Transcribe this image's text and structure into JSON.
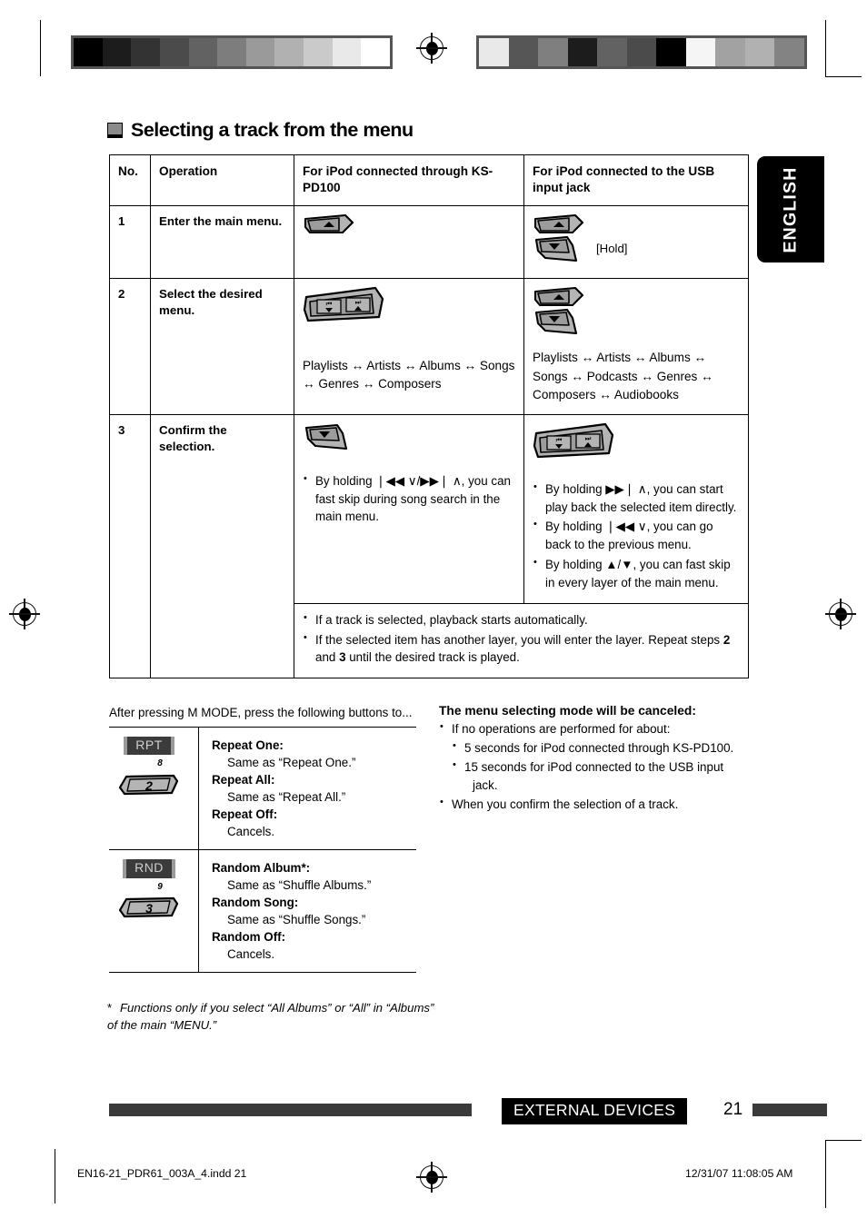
{
  "page": {
    "heading": "Selecting a track from the menu",
    "language_tab": "ENGLISH",
    "chapter_tag": "EXTERNAL DEVICES",
    "page_number": "21",
    "file_name": "EN16-21_PDR61_003A_4.indd   21",
    "timestamp": "12/31/07   11:08:05 AM"
  },
  "colorbars": {
    "left_swatches": [
      "#000000",
      "#1c1c1c",
      "#333333",
      "#4b4b4b",
      "#626262",
      "#7d7d7d",
      "#9a9a9a",
      "#b1b1b1",
      "#cacaca",
      "#e9e9e9",
      "#ffffff"
    ],
    "right_swatches": [
      "#e9e9e9",
      "#565656",
      "#7f7f7f",
      "#1c1c1c",
      "#626262",
      "#4b4b4b",
      "#000000",
      "#f5f5f5",
      "#a2a2a2",
      "#b1b1b1",
      "#838383"
    ]
  },
  "table": {
    "headers": {
      "no": "No.",
      "operation": "Operation",
      "ipod_pd100": "For iPod connected through KS-PD100",
      "ipod_usb": "For iPod connected to the USB input jack"
    },
    "rows": [
      {
        "no": "1",
        "operation": "Enter the main menu.",
        "pd100_hold_label": "",
        "usb_hold_label": "[Hold]"
      },
      {
        "no": "2",
        "operation": "Select the desired menu.",
        "pd100_sequence": "Playlists ↔ Artists ↔ Albums ↔ Songs ↔ Genres ↔ Composers",
        "usb_sequence": "Playlists ↔ Artists ↔ Albums ↔ Songs ↔ Podcasts ↔ Genres ↔ Composers ↔ Audiobooks"
      },
      {
        "no": "3",
        "operation": "Confirm the selection.",
        "pd100_bullets": [
          "By holding ❘◀◀ ∨/▶▶❘ ∧, you can fast skip during song search in the main menu."
        ],
        "usb_bullets": [
          "By holding ▶▶❘ ∧, you can start play back the selected item directly.",
          "By holding ❘◀◀ ∨, you can go back to the previous menu.",
          "By holding ▲/▼, you can fast skip in every layer of  the main menu."
        ]
      }
    ],
    "notes": [
      "If a track is selected, playback starts automatically.",
      "If the selected item has another layer, you will enter the layer. Repeat steps 2 and 3 until the desired track is played."
    ],
    "notes_bold_tokens": [
      "2",
      "3"
    ]
  },
  "mode_section": {
    "intro": "After pressing M MODE, press the following buttons to...",
    "groups": [
      {
        "button_plate": "RPT",
        "button_small_number": "8",
        "button_key_number": "2",
        "items": [
          {
            "title": "Repeat One:",
            "desc": "Same as “Repeat One.”"
          },
          {
            "title": "Repeat All:",
            "desc": "Same as “Repeat All.”"
          },
          {
            "title": "Repeat Off:",
            "desc": "Cancels."
          }
        ]
      },
      {
        "button_plate": "RND",
        "button_small_number": "9",
        "button_key_number": "3",
        "items": [
          {
            "title": "Random Album*:",
            "desc": "Same as “Shuffle Albums.”"
          },
          {
            "title": "Random Song:",
            "desc": "Same as “Shuffle Songs.”"
          },
          {
            "title": "Random Off:",
            "desc": "Cancels."
          }
        ]
      }
    ],
    "footnote_marker": "*",
    "footnote": "Functions only if you select “All Albums” or “All” in “Albums” of the main “MENU.”"
  },
  "cancel_section": {
    "title": "The menu selecting mode will be canceled:",
    "bullet_1": "If no operations are performed for about:",
    "sub_items": [
      {
        "text": "5 seconds for iPod connected through KS-PD100.",
        "cont": ""
      },
      {
        "text": "15 seconds for iPod connected to the USB input",
        "cont": "jack."
      }
    ],
    "bullet_2": "When you confirm the selection of a track."
  },
  "colors": {
    "key_fill": "#b4b4b4",
    "key_face": "#9c9c9c",
    "plate_bg": "#3b3b3b",
    "plate_text": "#cfcfcf",
    "rule": "#3a3a3a"
  }
}
